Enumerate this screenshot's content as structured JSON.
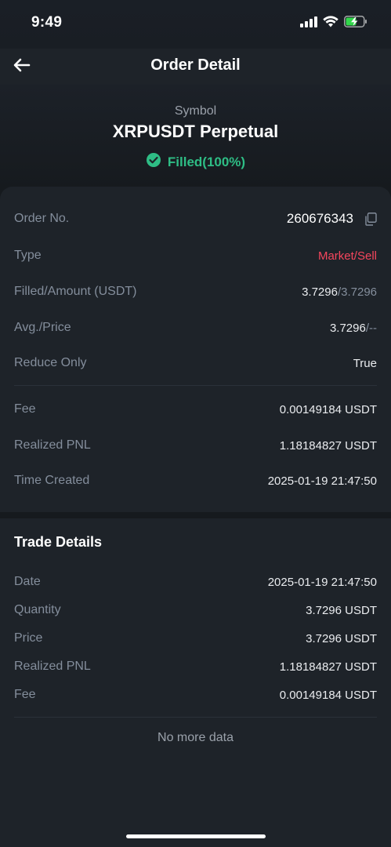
{
  "status_bar": {
    "time": "9:49"
  },
  "nav": {
    "title": "Order Detail"
  },
  "header": {
    "symbol_label": "Symbol",
    "symbol_name": "XRPUSDT Perpetual",
    "status": "Filled(100%)"
  },
  "order": {
    "order_no": {
      "label": "Order No.",
      "value": "260676343"
    },
    "type": {
      "label": "Type",
      "value": "Market/Sell"
    },
    "filled_amount": {
      "label": "Filled/Amount (USDT)",
      "filled": "3.7296",
      "amount": "/3.7296"
    },
    "avg_price": {
      "label": "Avg./Price",
      "avg": "3.7296",
      "price": "/--"
    },
    "reduce_only": {
      "label": "Reduce Only",
      "value": "True"
    },
    "fee": {
      "label": "Fee",
      "value": "0.00149184 USDT"
    },
    "realized_pnl": {
      "label": "Realized PNL",
      "value": "1.18184827 USDT"
    },
    "time_created": {
      "label": "Time Created",
      "value": "2025-01-19 21:47:50"
    }
  },
  "trade_details": {
    "title": "Trade Details",
    "rows": [
      {
        "label": "Date",
        "value": "2025-01-19 21:47:50"
      },
      {
        "label": "Quantity",
        "value": "3.7296 USDT"
      },
      {
        "label": "Price",
        "value": "3.7296 USDT"
      },
      {
        "label": "Realized PNL",
        "value": "1.18184827 USDT"
      },
      {
        "label": "Fee",
        "value": "0.00149184 USDT"
      }
    ],
    "no_more": "No more data"
  },
  "colors": {
    "background": "#1e2329",
    "success": "#2ebd85",
    "sell": "#f6465d",
    "label": "#848e9c"
  },
  "icons": [
    "signal-icon",
    "wifi-icon",
    "battery-charging-icon",
    "back-arrow-icon",
    "check-circle-icon",
    "copy-icon"
  ]
}
